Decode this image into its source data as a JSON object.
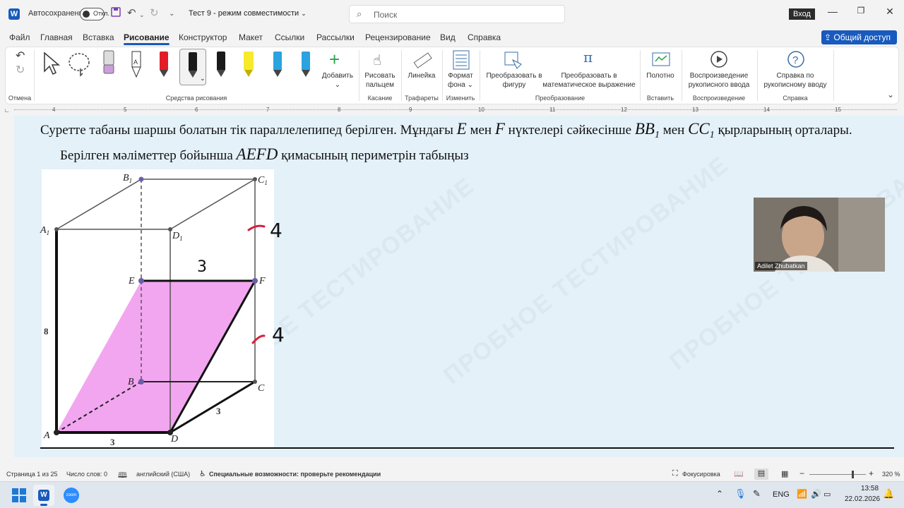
{
  "titlebar": {
    "app_icon": "W",
    "autosave_label": "Автосохранение",
    "autosave_state": "Откл.",
    "document_title": "Тест 9  -  режим совместимости",
    "search_placeholder": "Поиск",
    "signin_label": "Вход",
    "icons": [
      "save-icon",
      "undo-icon",
      "redo-icon",
      "customize-icon",
      "minimize-icon",
      "restore-icon",
      "close-icon"
    ]
  },
  "menu": {
    "tabs": [
      "Файл",
      "Главная",
      "Вставка",
      "Рисование",
      "Конструктор",
      "Макет",
      "Ссылки",
      "Рассылки",
      "Рецензирование",
      "Вид",
      "Справка"
    ],
    "active_tab": "Рисование",
    "share_label": "Общий доступ"
  },
  "ribbon": {
    "groups": {
      "undo": "Отмена",
      "drawing_tools": "Средства рисования",
      "touch": "Касание",
      "stencils": "Трафареты",
      "edit": "Изменить",
      "convert": "Преобразование",
      "insert": "Вставить",
      "replay": "Воспроизведение",
      "help": "Справка"
    },
    "buttons": {
      "add": "Добавить",
      "draw_with_finger": "Рисовать пальцем",
      "ruler": "Линейка",
      "format_background": "Формат фона",
      "convert_to_shape": "Преобразовать в фигуру",
      "convert_to_math": "Преобразовать в математическое выражение",
      "canvas": "Полотно",
      "ink_replay": "Воспроизведение рукописного ввода",
      "ink_help": "Справка по рукописному вводу"
    },
    "pen_colors": [
      "#444444",
      "#e21d25",
      "#1a1a1a",
      "#1a1a1a",
      "#f7ea2a",
      "#2aa3e0",
      "#2aa3e0"
    ]
  },
  "ruler": {
    "numbers": [
      "4",
      "5",
      "6",
      "7",
      "8",
      "9",
      "10",
      "11",
      "12",
      "13",
      "14",
      "15"
    ]
  },
  "document": {
    "line1_a": "Суретте табаны шаршы болатын тік параллелепипед берілген. Мұндағы ",
    "line1_E": "E",
    "line1_b": " мен ",
    "line1_F": "F",
    "line1_c": " нүктелері сәйкесінше ",
    "line1_BB1": "BB",
    "line1_sub1": "1",
    "line1_d": " мен ",
    "line1_CC1": "CC",
    "line1_sub2": "1",
    "line1_e": " қырларының орталары.",
    "line2_a": "Берілген мәліметтер бойынша ",
    "line2_AEFD": "AEFD",
    "line2_b": " қимасының периметрін табыңыз",
    "watermark": "ПРОБНОЕ ТЕСТИРОВАНИЕ",
    "figure": {
      "labels": {
        "A": "A",
        "B": "B",
        "C": "C",
        "D": "D",
        "A1": "A",
        "B1": "B",
        "C1": "C",
        "D1": "D",
        "sub1": "1",
        "E": "E",
        "F": "F",
        "len8": "8",
        "len3_bottom": "3",
        "len3_side": "3"
      },
      "handwritten": {
        "top_four": "4",
        "mid_four": "4",
        "three": "3"
      }
    }
  },
  "webcam": {
    "participant_name": "Adilet Zhubatkan"
  },
  "statusbar": {
    "page": "Страница 1 из 25",
    "words": "Число слов: 0",
    "language": "английский (США)",
    "accessibility": "Специальные возможности: проверьте рекомендации",
    "focus": "Фокусировка",
    "zoom_percent": "320 %"
  },
  "taskbar": {
    "language": "ENG",
    "time": "13:58",
    "date": "22.02.2026",
    "zoom_app_label": "zoom"
  },
  "colors": {
    "accent": "#185abd",
    "section_fill": "#f2a6f0",
    "handwriting_red": "#d8203a",
    "doc_bg": "#e4f1f9"
  }
}
